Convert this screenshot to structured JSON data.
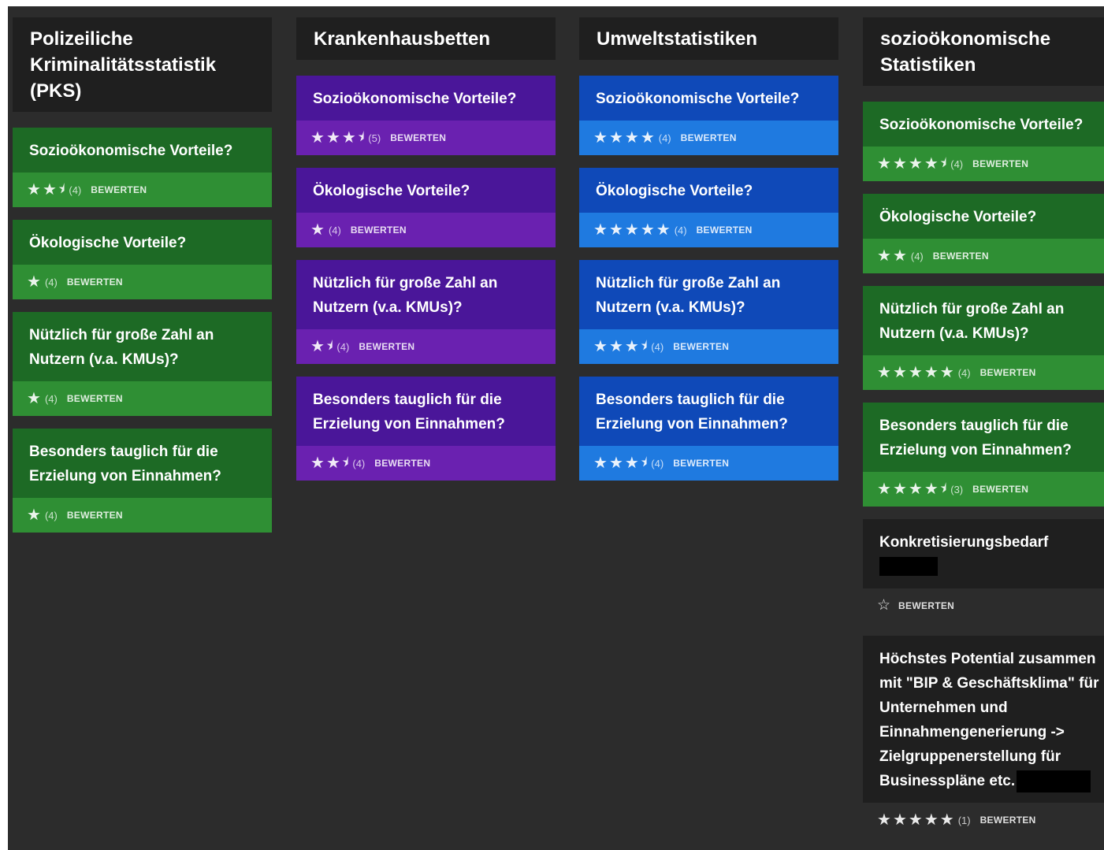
{
  "rate_label": "BEWERTEN",
  "columns": [
    {
      "title": "Polizeiliche Kriminalitätsstatistik (PKS)",
      "theme": "green",
      "cards": [
        {
          "title": "Sozioökonomische Vorteile?",
          "rating": 2.5,
          "count": "(4)"
        },
        {
          "title": "Ökologische Vorteile?",
          "rating": 1,
          "count": "(4)"
        },
        {
          "title": "Nützlich für große Zahl an Nutzern (v.a. KMUs)?",
          "rating": 1,
          "count": "(4)"
        },
        {
          "title": "Besonders tauglich für die Erzielung von Einnahmen?",
          "rating": 1,
          "count": "(4)"
        }
      ]
    },
    {
      "title": "Krankenhausbetten",
      "theme": "purple",
      "cards": [
        {
          "title": "Sozioökonomische Vorteile?",
          "rating": 3.5,
          "count": "(5)"
        },
        {
          "title": "Ökologische Vorteile?",
          "rating": 1,
          "count": "(4)"
        },
        {
          "title": "Nützlich für große Zahl an Nutzern (v.a. KMUs)?",
          "rating": 1.5,
          "count": "(4)"
        },
        {
          "title": "Besonders tauglich für die Erzielung von Einnahmen?",
          "rating": 2.5,
          "count": "(4)"
        }
      ]
    },
    {
      "title": "Umweltstatistiken",
      "theme": "blue",
      "cards": [
        {
          "title": "Sozioökonomische Vorteile?",
          "rating": 4,
          "count": "(4)"
        },
        {
          "title": "Ökologische Vorteile?",
          "rating": 5,
          "count": "(4)"
        },
        {
          "title": "Nützlich für große Zahl an Nutzern (v.a. KMUs)?",
          "rating": 3.5,
          "count": "(4)"
        },
        {
          "title": "Besonders tauglich für die Erzielung von Einnahmen?",
          "rating": 3.5,
          "count": "(4)"
        }
      ]
    },
    {
      "title": "sozioökonomische Statistiken",
      "theme": "green",
      "cards": [
        {
          "title": "Sozioökonomische Vorteile?",
          "rating": 4.5,
          "count": "(4)"
        },
        {
          "title": "Ökologische Vorteile?",
          "rating": 2,
          "count": "(4)"
        },
        {
          "title": "Nützlich für große Zahl an Nutzern (v.a. KMUs)?",
          "rating": 5,
          "count": "(4)"
        },
        {
          "title": "Besonders tauglich für die Erzielung von Einnahmen?",
          "rating": 4.5,
          "count": "(3)"
        },
        {
          "title": "Konkretisierungsbedarf",
          "theme": "dark",
          "rating": 0,
          "count": "",
          "redacted_line": true
        },
        {
          "title": "Höchstes Potential zusammen mit \"BIP & Geschäftsklima\" für Unternehmen und Einnahmengenerierung -> Zielgruppenerstellung für Businesspläne etc.",
          "theme": "dark",
          "rating": 5,
          "count": "(1)",
          "redacted_inline": true
        }
      ]
    }
  ]
}
